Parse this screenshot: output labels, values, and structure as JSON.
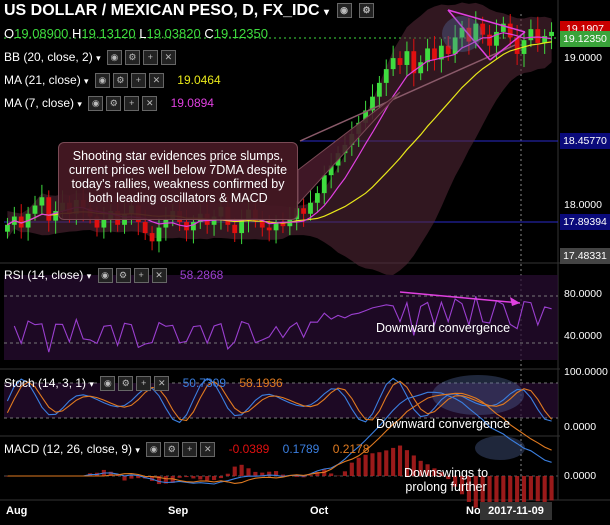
{
  "header": {
    "title": "US DOLLAR / MEXICAN PESO, D, FX_IDC",
    "ohlc": {
      "o_label": "O",
      "o": "19.08900",
      "h_label": "H",
      "h": "19.13120",
      "l_label": "L",
      "l": "19.03820",
      "c_label": "C",
      "c": "19.12350"
    }
  },
  "indicators": {
    "bb": {
      "label": "BB (20, close, 2)"
    },
    "ma21": {
      "label": "MA (21, close)",
      "value": "19.0464",
      "color": "#e8e81a"
    },
    "ma7": {
      "label": "MA (7, close)",
      "value": "19.0894",
      "color": "#e040e0"
    }
  },
  "annotation": "Shooting star evidences price slumps, current prices well below 7DMA despite today's rallies, weakness confirmed by both leading oscillators & MACD",
  "price_axis": {
    "tags": [
      {
        "value": "19.1907",
        "bg": "#c80000",
        "fg": "#fff"
      },
      {
        "value": "19.12350",
        "bg": "#3aa33a",
        "fg": "#fff"
      },
      {
        "value": "18.45770",
        "bg": "#0a0a7a",
        "fg": "#fff"
      },
      {
        "value": "17.89394",
        "bg": "#0a0a7a",
        "fg": "#fff"
      },
      {
        "value": "17.48331",
        "bg": "#444",
        "fg": "#fff"
      }
    ],
    "labels": [
      "19.0000",
      "18.0000"
    ]
  },
  "rsi": {
    "label": "RSI (14, close)",
    "value": "58.2868",
    "note": "Downward convergence",
    "axis": [
      "80.0000",
      "40.0000"
    ]
  },
  "stoch": {
    "label": "Stoch (14, 3, 1)",
    "k": "50.7309",
    "d": "58.1936",
    "note": "Downward convergence",
    "axis": [
      "100.0000",
      "0.0000"
    ]
  },
  "macd": {
    "label": "MACD (12, 26, close, 9)",
    "hist": "-0.0389",
    "macd": "0.1789",
    "signal": "0.2178",
    "note1": "Downswings to",
    "note2": "prolong further",
    "axis": [
      "0.0000"
    ]
  },
  "x_axis": {
    "labels": [
      "Aug",
      "Sep",
      "Oct",
      "Nov"
    ],
    "date_tag": "2017-11-09"
  },
  "colors": {
    "up": "#3fdc3f",
    "down": "#e01010",
    "bb": "#5a2a3a",
    "ma21": "#e8e81a",
    "ma7": "#e040e0",
    "rsi": "#9b3fd0",
    "stoch_k": "#3b7fe0",
    "stoch_d": "#e07a20",
    "macd": "#3b7fe0",
    "signal": "#e07a20",
    "arrow": "#e040e0"
  },
  "chart_data": {
    "type": "candlestick",
    "title": "US DOLLAR / MEXICAN PESO, D, FX_IDC",
    "ylim": [
      17.45,
      19.25
    ],
    "closes": [
      17.72,
      17.78,
      17.7,
      17.8,
      17.86,
      17.92,
      17.75,
      17.82,
      17.88,
      17.8,
      17.9,
      17.84,
      17.78,
      17.7,
      17.76,
      17.82,
      17.72,
      17.8,
      17.86,
      17.74,
      17.66,
      17.6,
      17.7,
      17.76,
      17.82,
      17.74,
      17.68,
      17.74,
      17.8,
      17.72,
      17.78,
      17.85,
      17.72,
      17.66,
      17.76,
      17.83,
      17.75,
      17.7,
      17.68,
      17.74,
      17.71,
      17.76,
      17.84,
      17.8,
      17.88,
      17.95,
      18.08,
      18.15,
      18.24,
      18.3,
      18.38,
      18.46,
      18.55,
      18.65,
      18.75,
      18.85,
      18.93,
      18.88,
      18.98,
      18.82,
      18.9,
      19.0,
      18.92,
      19.02,
      18.96,
      19.08,
      19.15,
      19.05,
      19.18,
      19.1,
      19.02,
      19.12,
      19.18,
      19.08,
      18.96,
      19.06,
      19.14,
      19.04,
      19.09,
      19.12
    ]
  }
}
